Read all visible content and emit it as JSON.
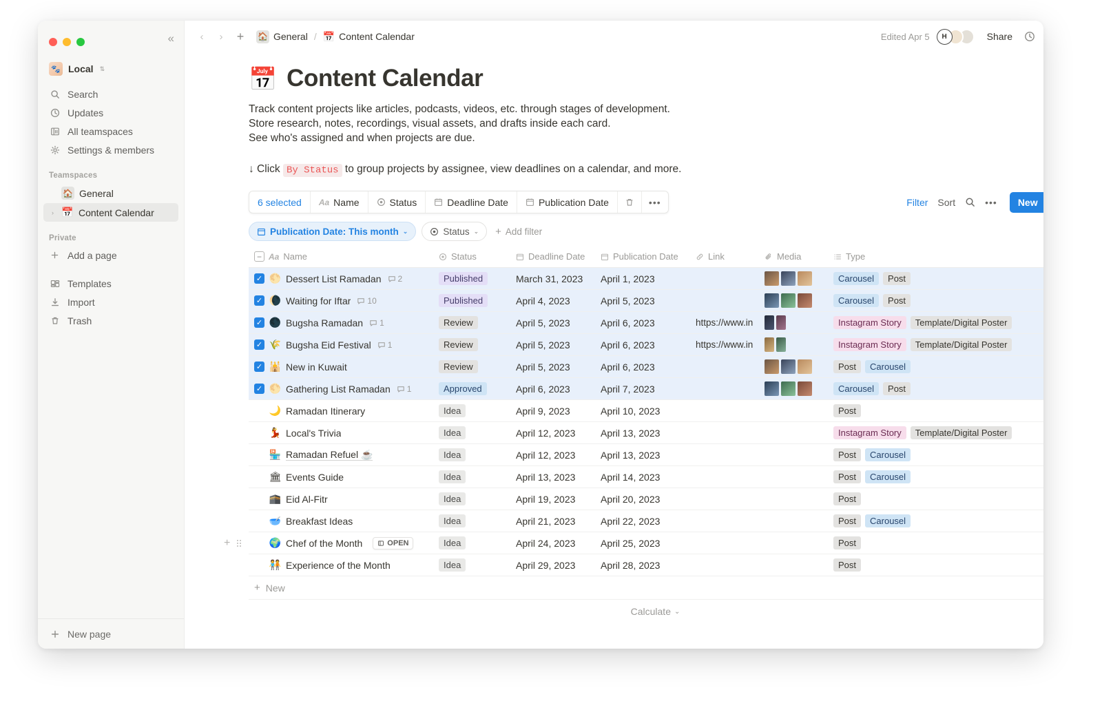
{
  "window": {
    "traffic_lights": [
      "close",
      "minimize",
      "maximize"
    ],
    "collapse_label": "«"
  },
  "sidebar": {
    "workspace": {
      "name": "Local",
      "avatar_emoji": "🐾"
    },
    "nav": [
      {
        "label": "Search",
        "icon": "search-icon"
      },
      {
        "label": "Updates",
        "icon": "clock-icon"
      },
      {
        "label": "All teamspaces",
        "icon": "teamspaces-icon"
      },
      {
        "label": "Settings & members",
        "icon": "gear-icon"
      }
    ],
    "teamspaces_header": "Teamspaces",
    "teamspaces": [
      {
        "label": "General",
        "icon": "🏠",
        "active": false
      },
      {
        "label": "Content Calendar",
        "icon": "📅",
        "active": true
      }
    ],
    "private_header": "Private",
    "private": [
      {
        "label": "Add a page",
        "icon": "plus-icon"
      }
    ],
    "tools": [
      {
        "label": "Templates",
        "icon": "templates-icon"
      },
      {
        "label": "Import",
        "icon": "import-icon"
      },
      {
        "label": "Trash",
        "icon": "trash-icon"
      }
    ],
    "footer": {
      "label": "New page",
      "icon": "plus-icon"
    }
  },
  "topbar": {
    "back": "‹",
    "forward": "›",
    "add": "+",
    "breadcrumb": [
      {
        "label": "General",
        "icon": "🏠"
      },
      {
        "label": "Content Calendar",
        "icon": "📅"
      }
    ],
    "separator": "/",
    "edited": "Edited Apr 5",
    "avatars": [
      {
        "initial": "H"
      },
      {
        "initial": ""
      },
      {
        "initial": ""
      }
    ],
    "share_label": "Share",
    "icons": [
      "clock-icon",
      "star-icon",
      "more-icon"
    ]
  },
  "page": {
    "emoji": "📅",
    "title": "Content Calendar",
    "description": [
      "Track content projects like articles, podcasts, videos, etc. through stages of development.",
      "Store research, notes, recordings, visual assets, and drafts inside each card.",
      "See who's assigned and when projects are due."
    ],
    "hint_prefix": "↓ Click",
    "hint_chip": "By Status",
    "hint_suffix": "to group projects by assignee, view deadlines on a calendar, and more."
  },
  "selection_toolbar": {
    "count_label": "6 selected",
    "items": [
      {
        "label": "Name",
        "icon": "Aa"
      },
      {
        "label": "Status",
        "icon": "status-icon"
      },
      {
        "label": "Deadline Date",
        "icon": "calendar-icon"
      },
      {
        "label": "Publication Date",
        "icon": "calendar-icon"
      }
    ],
    "trash_icon": "trash-icon",
    "more_icon": "more-icon"
  },
  "view_toolbar": {
    "filter_label": "Filter",
    "sort_label": "Sort",
    "search_icon": "search-icon",
    "more_icon": "more-icon",
    "new_label": "New",
    "new_chevron": "⌄"
  },
  "filters": {
    "chips": [
      {
        "label": "Publication Date: This month",
        "icon": "calendar-icon",
        "active": true
      },
      {
        "label": "Status",
        "icon": "status-icon",
        "active": false
      }
    ],
    "add_filter_label": "Add filter"
  },
  "table": {
    "columns": [
      {
        "key": "name",
        "label": "Name",
        "icon": "Aa"
      },
      {
        "key": "status",
        "label": "Status",
        "icon": "status-icon"
      },
      {
        "key": "deadline",
        "label": "Deadline Date",
        "icon": "calendar-icon"
      },
      {
        "key": "publication",
        "label": "Publication Date",
        "icon": "calendar-icon"
      },
      {
        "key": "link",
        "label": "Link",
        "icon": "link-icon"
      },
      {
        "key": "media",
        "label": "Media",
        "icon": "paperclip-icon"
      },
      {
        "key": "type",
        "label": "Type",
        "icon": "list-icon"
      }
    ],
    "add_column_icon": "plus-icon",
    "rows": [
      {
        "selected": true,
        "emoji": "🌕",
        "name": "Dessert List Ramadan",
        "comments": "2",
        "status": "Published",
        "status_class": "p-published",
        "deadline": "March 31, 2023",
        "publication": "April 1, 2023",
        "link": "",
        "media": 3,
        "media_shape": "square",
        "types": [
          {
            "label": "Carousel",
            "cls": "p-carousel"
          },
          {
            "label": "Post",
            "cls": "p-post"
          }
        ]
      },
      {
        "selected": true,
        "emoji": "🌘",
        "name": "Waiting for Iftar",
        "comments": "10",
        "status": "Published",
        "status_class": "p-published",
        "deadline": "April 4, 2023",
        "publication": "April 5, 2023",
        "link": "",
        "media": 3,
        "media_shape": "square",
        "types": [
          {
            "label": "Carousel",
            "cls": "p-carousel"
          },
          {
            "label": "Post",
            "cls": "p-post"
          }
        ]
      },
      {
        "selected": true,
        "emoji": "🌑",
        "name": "Bugsha Ramadan",
        "comments": "1",
        "status": "Review",
        "status_class": "p-review",
        "deadline": "April 5, 2023",
        "publication": "April 6, 2023",
        "link": "https://www.in",
        "media": 2,
        "media_shape": "tall",
        "types": [
          {
            "label": "Instagram Story",
            "cls": "p-story"
          },
          {
            "label": "Template/Digital Poster",
            "cls": "p-template"
          }
        ]
      },
      {
        "selected": true,
        "emoji": "🌾",
        "name": "Bugsha Eid Festival",
        "comments": "1",
        "status": "Review",
        "status_class": "p-review",
        "deadline": "April 5, 2023",
        "publication": "April 6, 2023",
        "link": "https://www.in",
        "media": 2,
        "media_shape": "tall",
        "types": [
          {
            "label": "Instagram Story",
            "cls": "p-story"
          },
          {
            "label": "Template/Digital Poster",
            "cls": "p-template"
          }
        ]
      },
      {
        "selected": true,
        "emoji": "🕌",
        "name": "New in Kuwait",
        "comments": "",
        "status": "Review",
        "status_class": "p-review",
        "deadline": "April 5, 2023",
        "publication": "April 6, 2023",
        "link": "",
        "media": 3,
        "media_shape": "square",
        "types": [
          {
            "label": "Post",
            "cls": "p-post"
          },
          {
            "label": "Carousel",
            "cls": "p-carousel"
          }
        ]
      },
      {
        "selected": true,
        "emoji": "🌕",
        "name": "Gathering List Ramadan",
        "comments": "1",
        "status": "Approved",
        "status_class": "p-approved",
        "deadline": "April 6, 2023",
        "publication": "April 7, 2023",
        "link": "",
        "media": 3,
        "media_shape": "square",
        "types": [
          {
            "label": "Carousel",
            "cls": "p-carousel"
          },
          {
            "label": "Post",
            "cls": "p-post"
          }
        ]
      },
      {
        "selected": false,
        "emoji": "🌙",
        "name": "Ramadan Itinerary",
        "comments": "",
        "status": "Idea",
        "status_class": "p-idea",
        "deadline": "April 9, 2023",
        "publication": "April 10, 2023",
        "link": "",
        "media": 0,
        "media_shape": "square",
        "types": [
          {
            "label": "Post",
            "cls": "p-post"
          }
        ]
      },
      {
        "selected": false,
        "emoji": "💃",
        "name": "Local's Trivia",
        "comments": "",
        "status": "Idea",
        "status_class": "p-idea",
        "deadline": "April 12, 2023",
        "publication": "April 13, 2023",
        "link": "",
        "media": 0,
        "media_shape": "square",
        "types": [
          {
            "label": "Instagram Story",
            "cls": "p-story"
          },
          {
            "label": "Template/Digital Poster",
            "cls": "p-template"
          }
        ]
      },
      {
        "selected": false,
        "emoji": "🏪",
        "name": "Ramadan Refuel ☕",
        "comments": "",
        "status": "Idea",
        "status_class": "p-idea",
        "deadline": "April 12, 2023",
        "publication": "April 13, 2023",
        "link": "",
        "media": 0,
        "media_shape": "square",
        "types": [
          {
            "label": "Post",
            "cls": "p-post"
          },
          {
            "label": "Carousel",
            "cls": "p-carousel"
          }
        ]
      },
      {
        "selected": false,
        "emoji": "🏛",
        "name": "Events Guide",
        "comments": "",
        "status": "Idea",
        "status_class": "p-idea",
        "deadline": "April 13, 2023",
        "publication": "April 14, 2023",
        "link": "",
        "media": 0,
        "media_shape": "square",
        "types": [
          {
            "label": "Post",
            "cls": "p-post"
          },
          {
            "label": "Carousel",
            "cls": "p-carousel"
          }
        ]
      },
      {
        "selected": false,
        "emoji": "🕋",
        "name": "Eid Al-Fitr",
        "comments": "",
        "status": "Idea",
        "status_class": "p-idea",
        "deadline": "April 19, 2023",
        "publication": "April 20, 2023",
        "link": "",
        "media": 0,
        "media_shape": "square",
        "types": [
          {
            "label": "Post",
            "cls": "p-post"
          }
        ]
      },
      {
        "selected": false,
        "emoji": "🥣",
        "name": "Breakfast Ideas",
        "comments": "",
        "status": "Idea",
        "status_class": "p-idea",
        "deadline": "April 21, 2023",
        "publication": "April 22, 2023",
        "link": "",
        "media": 0,
        "media_shape": "square",
        "types": [
          {
            "label": "Post",
            "cls": "p-post"
          },
          {
            "label": "Carousel",
            "cls": "p-carousel"
          }
        ]
      },
      {
        "selected": false,
        "emoji": "🌍",
        "name": "Chef of the Month",
        "comments": "",
        "open_button": "OPEN",
        "hovered": true,
        "status": "Idea",
        "status_class": "p-idea",
        "deadline": "April 24, 2023",
        "publication": "April 25, 2023",
        "link": "",
        "media": 0,
        "media_shape": "square",
        "types": [
          {
            "label": "Post",
            "cls": "p-post"
          }
        ]
      },
      {
        "selected": false,
        "emoji": "🧑‍🤝‍🧑",
        "name": "Experience of the Month",
        "comments": "",
        "status": "Idea",
        "status_class": "p-idea",
        "deadline": "April 29, 2023",
        "publication": "April 28, 2023",
        "link": "",
        "media": 0,
        "media_shape": "square",
        "types": [
          {
            "label": "Post",
            "cls": "p-post"
          }
        ]
      }
    ],
    "new_row_label": "New",
    "calculate_label": "Calculate"
  },
  "help": {
    "label": "?"
  },
  "colors": {
    "accent": "#2383e2",
    "sidebar_bg": "#f7f7f5",
    "selected_row": "#e8f0fb",
    "text": "#37352f",
    "muted": "#9b9a97"
  }
}
